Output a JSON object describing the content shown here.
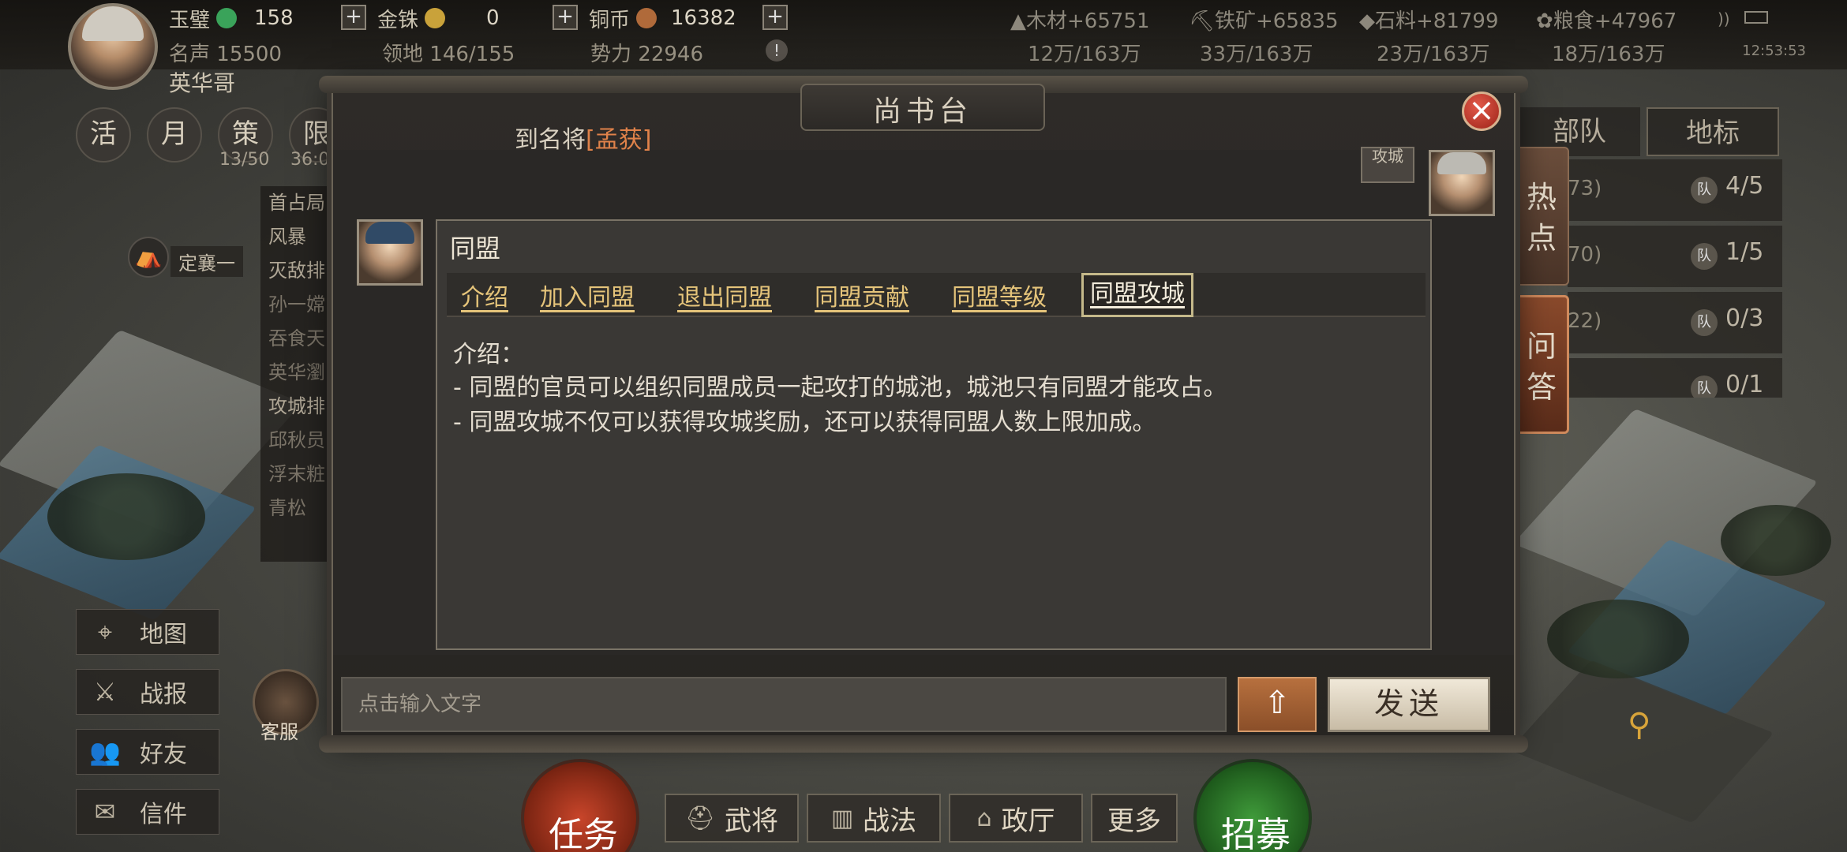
{
  "player": {
    "name": "英华哥",
    "fame_label": "名声",
    "fame_value": "15500",
    "territory_label": "领地",
    "territory_value": "146/155",
    "power_label": "势力",
    "power_value": "22946"
  },
  "currencies": [
    {
      "label": "玉璧",
      "value": "158",
      "icon": "jade-coin-icon",
      "color": "#3aa35a"
    },
    {
      "label": "金铢",
      "value": "0",
      "icon": "gold-coin-icon",
      "color": "#c9a23a"
    },
    {
      "label": "铜币",
      "value": "16382",
      "icon": "copper-coin-icon",
      "color": "#b06a3a"
    }
  ],
  "resources": [
    {
      "label": "木材+65751",
      "cap": "12万/163万"
    },
    {
      "label": "铁矿+65835",
      "cap": "33万/163万"
    },
    {
      "label": "石料+81799",
      "cap": "23万/163万"
    },
    {
      "label": "粮食+47967",
      "cap": "18万/163万"
    }
  ],
  "clock": "12:53:53",
  "left_round_buttons": [
    "活",
    "月",
    "策",
    "限"
  ],
  "left_counts": [
    "13/50",
    "36:0"
  ],
  "event_list": [
    "首占局",
    "风暴",
    "灭敌排",
    "孙一嫦",
    "吞食天",
    "英华瀏",
    "攻城排",
    "邱秋员",
    "浮末粧",
    "青松"
  ],
  "region_banner": "定襄一",
  "sidebar": [
    {
      "label": "地图",
      "icon": "map-pin-icon"
    },
    {
      "label": "战报",
      "icon": "crossed-swords-icon"
    },
    {
      "label": "好友",
      "icon": "friends-icon"
    },
    {
      "label": "信件",
      "icon": "mail-icon"
    }
  ],
  "customer_service": "客服",
  "right_tabs": {
    "tab1": "部队",
    "tab2": "地标"
  },
  "right_rows": [
    {
      "num": "73)",
      "count": "4/5"
    },
    {
      "num": "70)",
      "count": "1/5"
    },
    {
      "num": "22)",
      "count": "0/3"
    },
    {
      "num": "",
      "count": "0/1"
    }
  ],
  "queue_badge": "队",
  "vtabs": {
    "hot": "热点",
    "qa": "问答"
  },
  "bottom": {
    "task": "任务",
    "generals": "武将",
    "tactics": "战法",
    "government": "政厅",
    "more": "更多",
    "recruit": "招募"
  },
  "dialog": {
    "title": "尚书台",
    "close": "×",
    "notice_prefix": "到名将",
    "notice_hero": "[孟获]",
    "tag_text": "攻城",
    "bubble_title": "同盟",
    "tabs": [
      "介绍",
      "加入同盟",
      "退出同盟",
      "同盟贡献",
      "同盟等级",
      "同盟攻城"
    ],
    "active_tab": "同盟攻城",
    "body_lines": [
      "介绍：",
      "- 同盟的官员可以组织同盟成员一起攻打的城池，城池只有同盟才能攻占。",
      "- 同盟攻城不仅可以获得攻城奖励，还可以获得同盟人数上限加成。"
    ],
    "input_placeholder": "点击输入文字",
    "up_label": "⇧",
    "send_label": "发送"
  }
}
